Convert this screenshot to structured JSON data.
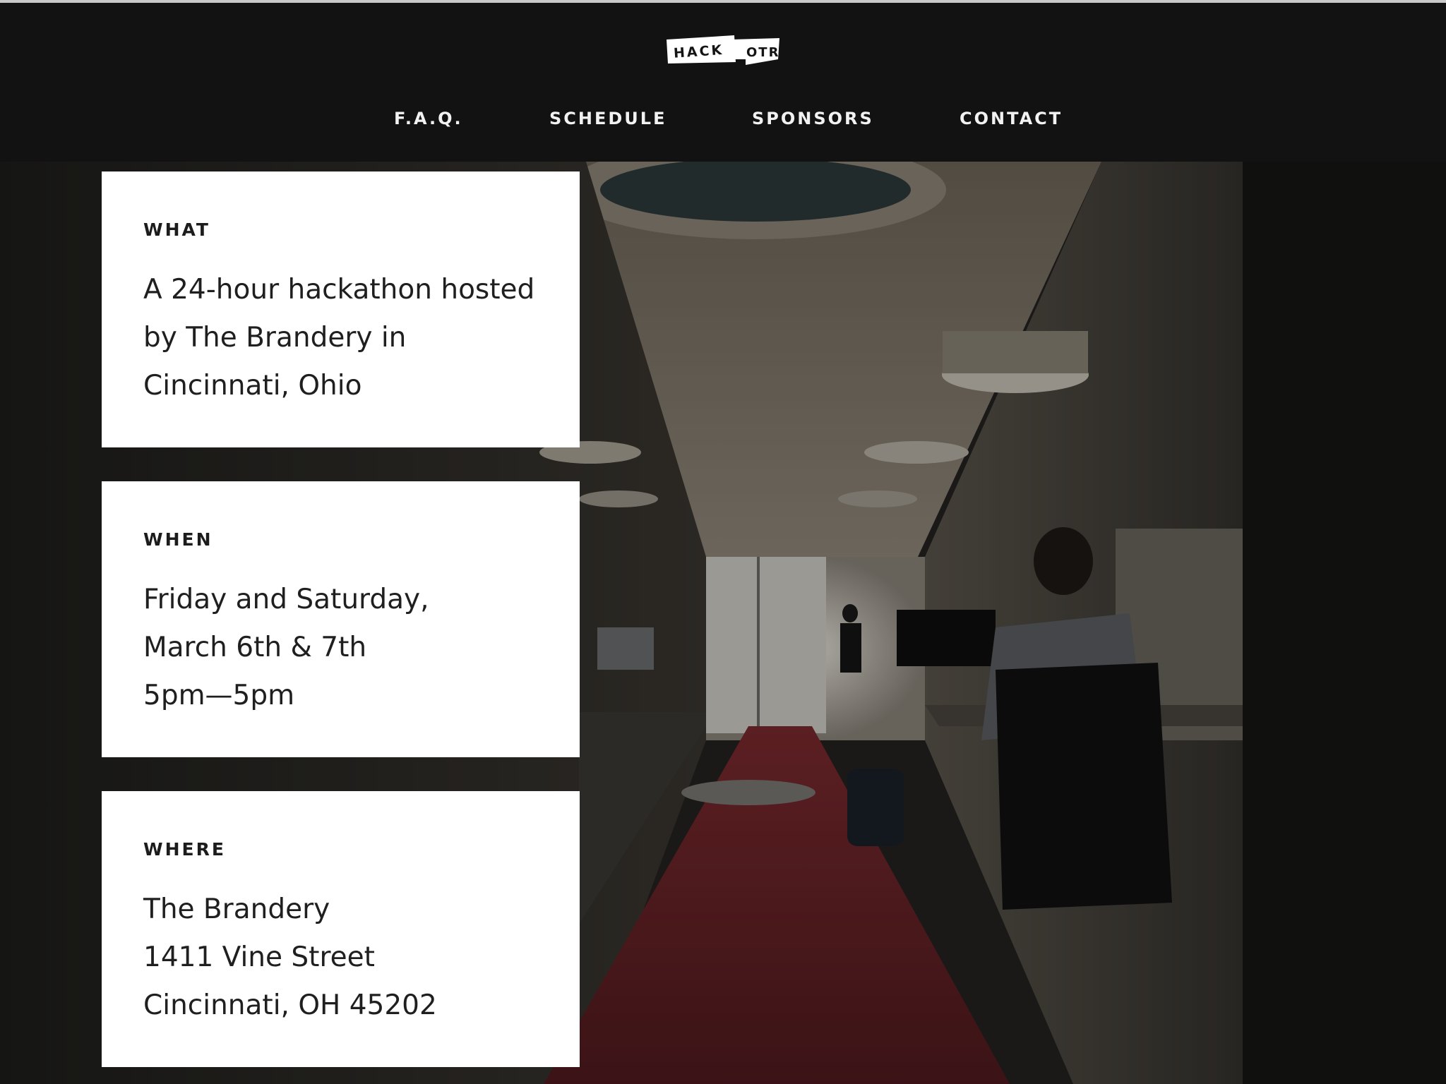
{
  "logo": {
    "word_left": "HACK",
    "word_right": "OTR"
  },
  "nav": {
    "items": [
      {
        "label": "F.A.Q."
      },
      {
        "label": "SCHEDULE"
      },
      {
        "label": "SPONSORS"
      },
      {
        "label": "CONTACT"
      }
    ]
  },
  "cards": [
    {
      "label": "WHAT",
      "lines": [
        "A 24-hour hackathon hosted",
        "by The Brandery in",
        "Cincinnati, Ohio"
      ]
    },
    {
      "label": "WHEN",
      "lines": [
        "Friday and Saturday,",
        "March 6th & 7th",
        "5pm—5pm"
      ]
    },
    {
      "label": "WHERE",
      "lines": [
        "The Brandery",
        "1411 Vine Street",
        "Cincinnati, OH 45202"
      ]
    }
  ],
  "colors": {
    "header_bg": "#121212",
    "card_bg": "#ffffff",
    "carpet_red": "#6e2328"
  },
  "icons": {
    "logo": "hackotr-logo"
  }
}
